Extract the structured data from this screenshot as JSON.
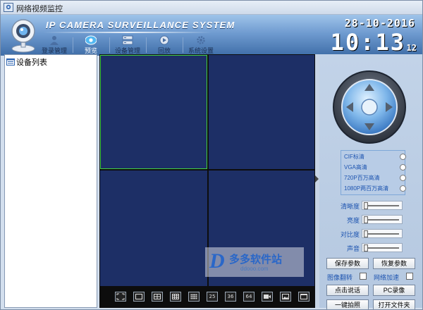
{
  "window": {
    "title": "网络视频监控"
  },
  "header": {
    "system_title": "IP CAMERA SURVEILLANCE SYSTEM",
    "nav": [
      {
        "label": "登录管理",
        "icon": "user-login-icon"
      },
      {
        "label": "预览",
        "icon": "preview-eye-icon",
        "active": true
      },
      {
        "label": "设备管理",
        "icon": "device-manage-icon"
      },
      {
        "label": "回放",
        "icon": "playback-icon"
      },
      {
        "label": "系统设置",
        "icon": "settings-gear-icon"
      }
    ],
    "date": "28-10-2016",
    "time": "10:13",
    "seconds": "12"
  },
  "device_list": {
    "label": "设备列表"
  },
  "video": {
    "selected_pane": 0,
    "toolbar": [
      {
        "name": "fullscreen-icon",
        "label": ""
      },
      {
        "name": "layout-1-icon",
        "label": ""
      },
      {
        "name": "layout-4-icon",
        "label": ""
      },
      {
        "name": "layout-9-icon",
        "label": ""
      },
      {
        "name": "layout-16-icon",
        "label": ""
      },
      {
        "name": "layout-25-button",
        "label": "25"
      },
      {
        "name": "layout-36-button",
        "label": "36"
      },
      {
        "name": "layout-64-button",
        "label": "64"
      },
      {
        "name": "record-icon",
        "label": ""
      },
      {
        "name": "snapshot-icon",
        "label": ""
      },
      {
        "name": "window-icon",
        "label": ""
      }
    ]
  },
  "controls": {
    "resolutions": [
      "CIF标清",
      "VGA高清",
      "720P百万高清",
      "1080P两百万高清"
    ],
    "sliders": [
      {
        "label": "清晰度",
        "value": 0.0
      },
      {
        "label": "亮度",
        "value": 0.0
      },
      {
        "label": "对比度",
        "value": 0.0
      },
      {
        "label": "声音",
        "value": 0.0
      }
    ],
    "save_params": "保存参数",
    "restore_params": "恢复参数",
    "image_flip": "图像翻转",
    "network_accel": "网络加速",
    "talk": "点击说话",
    "pc_record": "PC录像",
    "snapshot": "一键拍照",
    "open_folder": "打开文件夹"
  },
  "watermark": {
    "name": "多多软件站",
    "url": "ddooo.com"
  },
  "colors": {
    "pane": "#1d2f66",
    "selected_border": "#43d043",
    "header_top": "#9fc4ea",
    "header_bottom": "#3f6ea8"
  }
}
